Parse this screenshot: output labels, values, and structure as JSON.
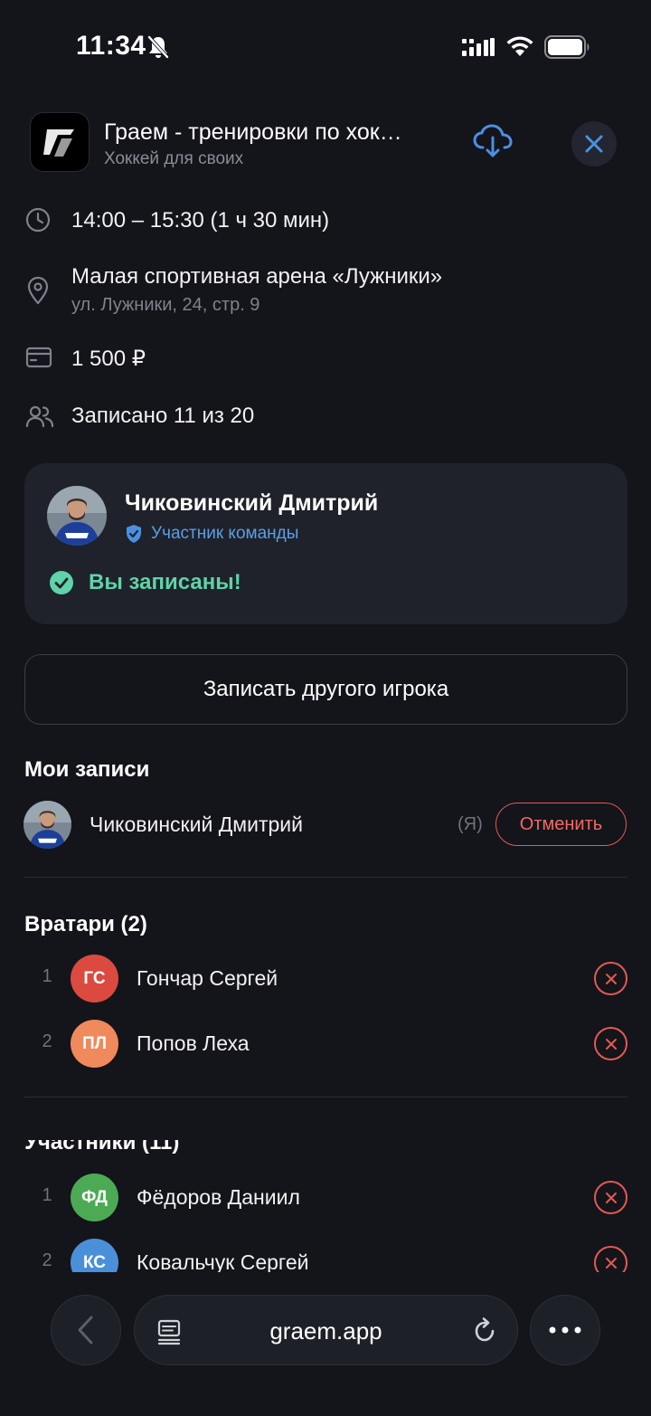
{
  "status_bar": {
    "time": "11:34"
  },
  "header": {
    "title": "Граем - тренировки по хок…",
    "subtitle": "Хоккей для своих"
  },
  "event": {
    "time": "14:00 – 15:30 (1 ч 30 мин)",
    "venue_name": "Малая спортивная арена «Лужники»",
    "venue_address": "ул. Лужники, 24, стр. 9",
    "price": "1 500 ₽",
    "enrolled": "Записано 11 из 20"
  },
  "player_card": {
    "name": "Чиковинский Дмитрий",
    "badge": "Участник команды",
    "status": "Вы записаны!"
  },
  "add_player_button": "Записать другого игрока",
  "my_entries": {
    "title": "Мои записи",
    "items": [
      {
        "name": "Чиковинский Дмитрий",
        "me_label": "(Я)",
        "cancel_label": "Отменить"
      }
    ]
  },
  "goalies": {
    "title": "Вратари (2)",
    "items": [
      {
        "index": "1",
        "initials": "ГС",
        "name": "Гончар Сергей",
        "color": "#dc4a3f"
      },
      {
        "index": "2",
        "initials": "ПЛ",
        "name": "Попов Леха",
        "color": "#f0895c"
      }
    ]
  },
  "participants": {
    "title": "Участники (11)",
    "items": [
      {
        "index": "1",
        "initials": "ФД",
        "name": "Фёдоров Даниил",
        "color": "#4caa55"
      },
      {
        "index": "2",
        "initials": "КС",
        "name": "Ковальчук Сергей",
        "color": "#4a90d9"
      }
    ]
  },
  "browser": {
    "url": "graem.app"
  },
  "colors": {
    "background": "#14141b",
    "card": "#1f222a",
    "accent_blue": "#4a90e2",
    "success_green": "#5fd3a9",
    "danger_red": "#e25a52"
  }
}
